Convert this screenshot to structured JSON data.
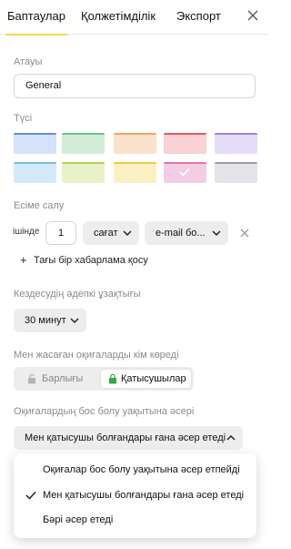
{
  "tabs": [
    {
      "label": "Баптаулар",
      "active": true
    },
    {
      "label": "Қолжетімділік",
      "active": false
    },
    {
      "label": "Экспорт",
      "active": false
    }
  ],
  "name": {
    "label": "Атауы",
    "value": "General"
  },
  "color": {
    "label": "Түсі",
    "swatches": [
      {
        "fill": "#d4e2fa",
        "stripe": "#5d8ee2"
      },
      {
        "fill": "#d2ecd8",
        "stripe": "#72c08a"
      },
      {
        "fill": "#fae2cc",
        "stripe": "#f0a564"
      },
      {
        "fill": "#f8d2d4",
        "stripe": "#e0595f"
      },
      {
        "fill": "#e5dcfa",
        "stripe": "#9b80e6"
      },
      {
        "fill": "#d5eaf8",
        "stripe": "#79bce6"
      },
      {
        "fill": "#e8f1c8",
        "stripe": "#b7cf4e"
      },
      {
        "fill": "#fbefc4",
        "stripe": "#f1cc3f"
      },
      {
        "fill": "#f5cce6",
        "stripe": "#e273b9",
        "selected": true
      },
      {
        "fill": "#e3e3e8",
        "stripe": "#9a9aa5"
      }
    ]
  },
  "reminder": {
    "label": "Есіме салу",
    "within_label": "ішінде",
    "amount": "1",
    "unit": "сағат",
    "method": "e-mail бо...",
    "add_label": "Тағы бір хабарлама қосу"
  },
  "duration": {
    "label": "Кездесудің әдепкі ұзақтығы",
    "value": "30 минут"
  },
  "visibility": {
    "label": "Мен жасаған оқиғаларды кім көреді",
    "options": [
      "Барлығы",
      "Қатысушылар"
    ],
    "selected": "Қатысушылар"
  },
  "busy": {
    "label": "Оқиғалардың бос болу уақытына әсері",
    "value": "Мен қатысушы болғандары ғана әсер етеді",
    "options": [
      "Оқиғалар бос болу уақытына әсер етпейді",
      "Мен қатысушы болғандары ғана әсер етеді",
      "Бәрі әсер етеді"
    ]
  },
  "icons": {
    "close": "close-icon",
    "chevron": "chevron-down-icon",
    "lock": "lock-icon",
    "check": "check-icon",
    "plus": "plus-icon"
  },
  "colors": {
    "accent_underline": "#f7d94c",
    "lock_active": "#36a93f",
    "lock_inactive": "#b4b4b4"
  }
}
